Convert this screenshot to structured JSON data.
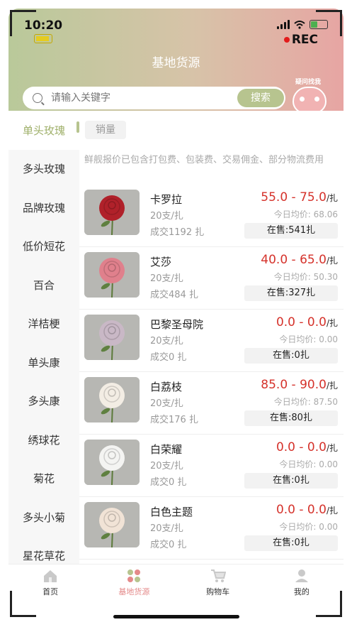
{
  "status": {
    "time": "10:20",
    "rec": "REC"
  },
  "header": {
    "title": "基地货源",
    "mascot_label": "疑问找我"
  },
  "search": {
    "placeholder": "请输入关键字",
    "button": "搜索"
  },
  "sidebar": {
    "items": [
      {
        "label": "单头玫瑰",
        "active": true
      },
      {
        "label": "多头玫瑰"
      },
      {
        "label": "品牌玫瑰"
      },
      {
        "label": "低价短花"
      },
      {
        "label": "百合"
      },
      {
        "label": "洋桔梗"
      },
      {
        "label": "单头康"
      },
      {
        "label": "多头康"
      },
      {
        "label": "绣球花"
      },
      {
        "label": "菊花"
      },
      {
        "label": "多头小菊"
      },
      {
        "label": "星花草花"
      }
    ]
  },
  "sort": {
    "label": "销量"
  },
  "notice": "鲜舰报价已包含打包费、包装费、交易佣金、部分物流费用",
  "products": [
    {
      "name": "卡罗拉",
      "spec": "20支/扎",
      "deal": "成交1192 扎",
      "price": "55.0 - 75.0",
      "unit": "/扎",
      "avg": "今日均价: 68.06",
      "stock": "在售:541扎",
      "flower_color": "#b0212a"
    },
    {
      "name": "艾莎",
      "spec": "20支/扎",
      "deal": "成交484 扎",
      "price": "40.0 - 65.0",
      "unit": "/扎",
      "avg": "今日均价: 50.30",
      "stock": "在售:327扎",
      "flower_color": "#e0808c"
    },
    {
      "name": "巴黎圣母院",
      "spec": "20支/扎",
      "deal": "成交0 扎",
      "price": "0.0 - 0.0",
      "unit": "/扎",
      "avg": "今日均价: 0.00",
      "stock": "在售:0扎",
      "flower_color": "#c9b8c6"
    },
    {
      "name": "白荔枝",
      "spec": "20支/扎",
      "deal": "成交176 扎",
      "price": "85.0 - 90.0",
      "unit": "/扎",
      "avg": "今日均价: 87.50",
      "stock": "在售:80扎",
      "flower_color": "#f3ede4"
    },
    {
      "name": "白荣耀",
      "spec": "20支/扎",
      "deal": "成交0 扎",
      "price": "0.0 - 0.0",
      "unit": "/扎",
      "avg": "今日均价: 0.00",
      "stock": "在售:0扎",
      "flower_color": "#f4f4f2"
    },
    {
      "name": "白色主题",
      "spec": "20支/扎",
      "deal": "成交0 扎",
      "price": "0.0 - 0.0",
      "unit": "/扎",
      "avg": "今日均价: 0.00",
      "stock": "在售:0扎",
      "flower_color": "#f1e3d6"
    }
  ],
  "tabs": [
    {
      "label": "首页",
      "icon": "home-icon"
    },
    {
      "label": "基地货源",
      "icon": "grid-icon",
      "active": true
    },
    {
      "label": "购物车",
      "icon": "cart-icon"
    },
    {
      "label": "我的",
      "icon": "user-icon"
    }
  ],
  "colors": {
    "accent": "#b7c48f",
    "price": "#d5322b",
    "tab_active": "#e48a8a"
  }
}
